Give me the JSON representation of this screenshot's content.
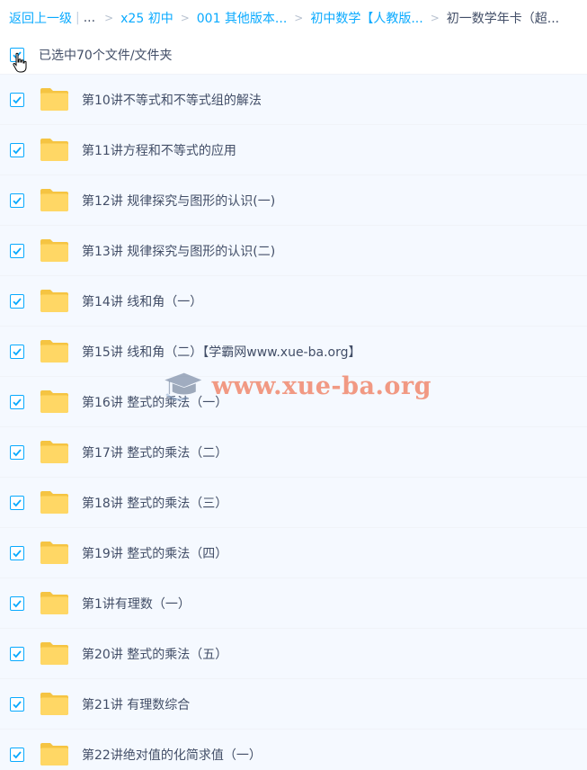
{
  "breadcrumb": {
    "back_label": "返回上一级",
    "separator": "|",
    "ellipsis": "...",
    "arrow": ">",
    "items": [
      "x25 初中",
      "001 其他版本...",
      "初中数学【人教版...",
      "初一数学年卡（超..."
    ]
  },
  "selection": {
    "text": "已选中70个文件/文件夹"
  },
  "files": [
    {
      "name": "第10讲不等式和不等式组的解法",
      "checked": true
    },
    {
      "name": "第11讲方程和不等式的应用",
      "checked": true
    },
    {
      "name": "第12讲 规律探究与图形的认识(一)",
      "checked": true
    },
    {
      "name": "第13讲 规律探究与图形的认识(二)",
      "checked": true
    },
    {
      "name": "第14讲 线和角（一）",
      "checked": true
    },
    {
      "name": "第15讲 线和角（二）【学霸网www.xue-ba.org】",
      "checked": true
    },
    {
      "name": "第16讲 整式的乘法（一）",
      "checked": true
    },
    {
      "name": "第17讲 整式的乘法（二）",
      "checked": true
    },
    {
      "name": "第18讲 整式的乘法（三）",
      "checked": true
    },
    {
      "name": "第19讲 整式的乘法（四）",
      "checked": true
    },
    {
      "name": "第1讲有理数（一）",
      "checked": true
    },
    {
      "name": "第20讲 整式的乘法（五）",
      "checked": true
    },
    {
      "name": "第21讲 有理数综合",
      "checked": true
    },
    {
      "name": "第22讲绝对值的化简求值（一）",
      "checked": true
    }
  ],
  "watermark": {
    "text": "www.xue-ba.org"
  },
  "colors": {
    "accent": "#09aaff",
    "folder": "#ffd765",
    "row_bg": "#f5f9ff",
    "text": "#424e67"
  }
}
